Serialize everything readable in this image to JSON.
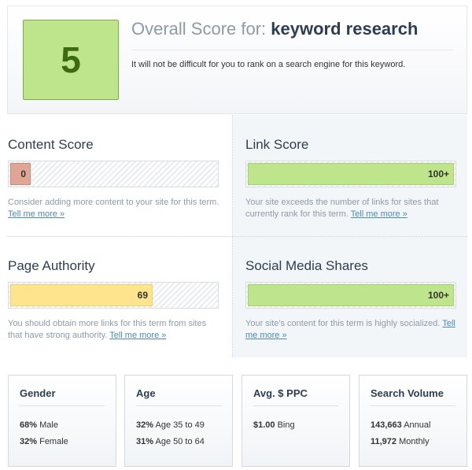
{
  "overall": {
    "score": "5",
    "title_prefix": "Overall Score for:",
    "keyword": "keyword research",
    "description": "It will not be difficult for you to rank on a search engine for this keyword."
  },
  "content_score": {
    "title": "Content Score",
    "value": "0",
    "fill_percent": 10,
    "description": "Consider adding more content to your site for this term.",
    "link": "Tell me more »"
  },
  "link_score": {
    "title": "Link Score",
    "value": "100+",
    "fill_percent": 100,
    "description": "Your site exceeds the number of links for sites that currently rank for this term.",
    "link": "Tell me more »"
  },
  "page_authority": {
    "title": "Page Authority",
    "value": "69",
    "fill_percent": 69,
    "description": "You should obtain more links for this term from sites that have strong authority.",
    "link": "Tell me more »"
  },
  "social_shares": {
    "title": "Social Media Shares",
    "value": "100+",
    "fill_percent": 100,
    "description": "Your site's content for this term is highly socialized.",
    "link": "Tell me more »"
  },
  "stats": {
    "gender": {
      "title": "Gender",
      "lines": [
        {
          "value": "68%",
          "label": "Male"
        },
        {
          "value": "32%",
          "label": "Female"
        }
      ]
    },
    "age": {
      "title": "Age",
      "lines": [
        {
          "value": "32%",
          "label": "Age 35 to 49"
        },
        {
          "value": "31%",
          "label": "Age 50 to 64"
        }
      ]
    },
    "ppc": {
      "title": "Avg. $ PPC",
      "lines": [
        {
          "value": "$1.00",
          "label": "Bing"
        }
      ]
    },
    "volume": {
      "title": "Search Volume",
      "lines": [
        {
          "value": "143,663",
          "label": "Annual"
        },
        {
          "value": "11,972",
          "label": "Monthly"
        }
      ]
    }
  },
  "colors": {
    "good": "#bfe58c",
    "medium": "#ffe48e",
    "bad": "#e0a594",
    "heading": "#2e3e52",
    "link": "#4a8ab5"
  }
}
